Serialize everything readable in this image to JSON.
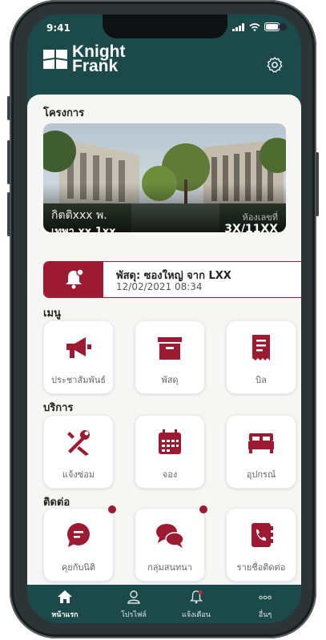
{
  "status_bar": {
    "time": "9:41"
  },
  "header": {
    "brand_line1": "Knight",
    "brand_line2": "Frank"
  },
  "project": {
    "section_title": "โครงการ",
    "name": "กิตติxxx พ.",
    "sub": "เทพา xx 1xx",
    "unit_label": "ห้องเลขที่",
    "unit": "3X/11XX"
  },
  "notice": {
    "title": "พัสดุ: ซองใหญ่ จาก LXX",
    "datetime": "12/02/2021 08:34"
  },
  "menu": {
    "title": "เมนู",
    "items": [
      {
        "label": "ประชาสัมพันธ์",
        "icon": "megaphone-icon"
      },
      {
        "label": "พัสดุ",
        "icon": "box-icon"
      },
      {
        "label": "บิล",
        "icon": "bill-icon"
      }
    ]
  },
  "services": {
    "title": "บริการ",
    "items": [
      {
        "label": "แจ้งซ่อม",
        "icon": "tools-icon"
      },
      {
        "label": "จอง",
        "icon": "calendar-icon"
      },
      {
        "label": "อุปกรณ์",
        "icon": "bed-icon"
      }
    ]
  },
  "contact": {
    "title": "ติดต่อ",
    "items": [
      {
        "label": "คุยกับนิติ",
        "icon": "chat-icon",
        "badge": true
      },
      {
        "label": "กลุ่มสนทนา",
        "icon": "group-chat-icon",
        "badge": true
      },
      {
        "label": "รายชื่อติดต่อ",
        "icon": "contacts-icon",
        "badge": false
      }
    ]
  },
  "tabbar": [
    {
      "label": "หน้าแรก",
      "icon": "home-icon",
      "active": true
    },
    {
      "label": "โปรไฟล์",
      "icon": "profile-icon",
      "active": false
    },
    {
      "label": "แจ้งเตือน",
      "icon": "bell-icon",
      "active": false
    },
    {
      "label": "อื่นๆ",
      "icon": "more-icon",
      "active": false
    }
  ],
  "colors": {
    "primary": "#1c4a4a",
    "accent": "#9d1b32"
  }
}
